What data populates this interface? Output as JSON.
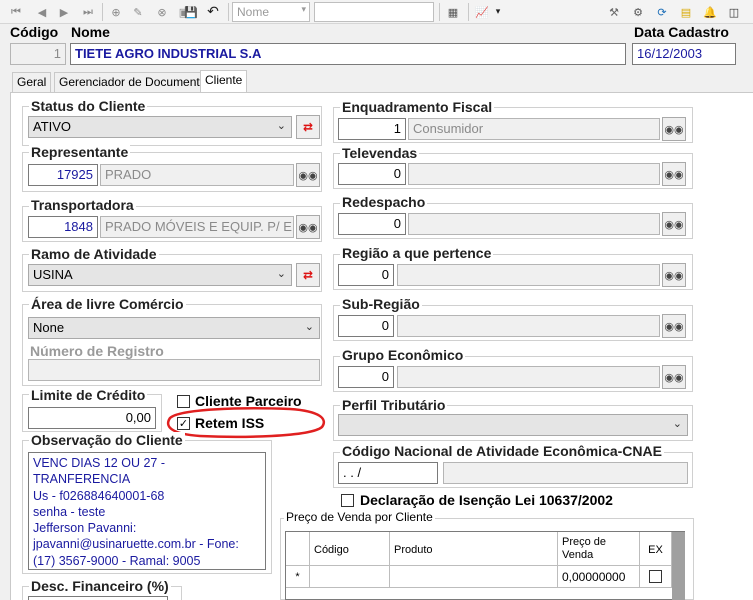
{
  "toolbar": {
    "name_combo_value": "Nome",
    "combo_arrow_icon": "chevron-down-icon"
  },
  "header": {
    "codigo_label": "Código",
    "codigo_value": "1",
    "nome_label": "Nome",
    "nome_value": "TIETE AGRO INDUSTRIAL S.A",
    "data_cadastro_label": "Data Cadastro",
    "data_cadastro_value": "16/12/2003"
  },
  "tabs": [
    {
      "label": "Geral",
      "active": false
    },
    {
      "label": "Gerenciador de Documentos",
      "active": false
    },
    {
      "label": "Cliente",
      "active": true
    }
  ],
  "left": {
    "status": {
      "label": "Status do Cliente",
      "value": "ATIVO"
    },
    "representante": {
      "label": "Representante",
      "code": "17925",
      "name": "PRADO"
    },
    "transportadora": {
      "label": "Transportadora",
      "code": "1848",
      "name": "PRADO MÓVEIS E EQUIP. P/ E"
    },
    "ramo": {
      "label": "Ramo de Atividade",
      "value": "USINA"
    },
    "area_livre": {
      "label": "Área de livre Comércio",
      "value": "None",
      "registro_label": "Número de Registro",
      "registro_value": ""
    },
    "limite": {
      "label": "Limite de Crédito",
      "value": "0,00"
    },
    "cliente_parceiro": {
      "label": "Cliente Parceiro",
      "checked": false
    },
    "retem_iss": {
      "label": "Retem ISS",
      "checked": true
    },
    "observacao": {
      "label": "Observação do Cliente",
      "lines": [
        "VENC DIAS 12 OU 27 -",
        "TRANFERENCIA",
        "Us - f026884640001-68",
        "senha - teste",
        "Jefferson Pavanni:",
        "jpavanni@usinaruette.com.br - Fone:",
        "(17) 3567-9000 - Ramal: 9005"
      ]
    },
    "desc_financeiro": {
      "label": "Desc. Financeiro (%)"
    }
  },
  "right": {
    "enquadramento": {
      "label": "Enquadramento Fiscal",
      "code": "1",
      "name": "Consumidor"
    },
    "televendas": {
      "label": "Televendas",
      "code": "0",
      "name": ""
    },
    "redespacho": {
      "label": "Redespacho",
      "code": "0",
      "name": ""
    },
    "regiao": {
      "label": "Região a que pertence",
      "code": "0",
      "name": ""
    },
    "sub_regiao": {
      "label": "Sub-Região",
      "code": "0",
      "name": ""
    },
    "grupo_economico": {
      "label": "Grupo Econômico",
      "code": "0",
      "name": ""
    },
    "perfil_tributario": {
      "label": "Perfil Tributário",
      "value": ""
    },
    "cnae": {
      "label": "Código Nacional de Atividade Econômica-CNAE",
      "code": " . . /",
      "name": ""
    },
    "declaracao": {
      "label": "Declaração de Isenção Lei 10637/2002",
      "checked": false
    }
  },
  "precos": {
    "title": "Preço de Venda por Cliente",
    "columns": [
      "Código",
      "Produto",
      "Preço de Venda",
      "EX"
    ],
    "new_row_marker": "*",
    "new_row_price": "0,00000000"
  },
  "annotation_color": "#e02020"
}
